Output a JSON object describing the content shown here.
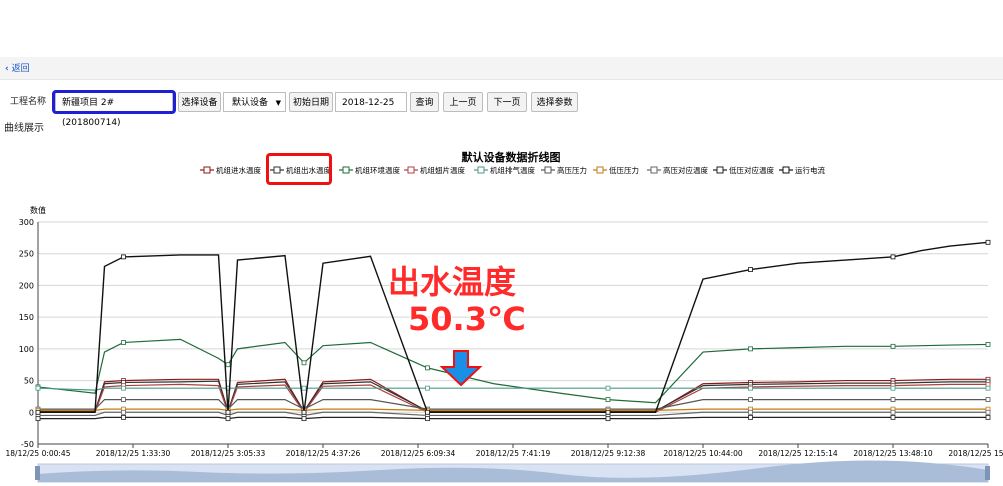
{
  "nav": {
    "back_label": "返回"
  },
  "toolbar": {
    "project_label": "工程名称",
    "project_value": "新疆项目 2#(201800714)",
    "device_label": "选择设备",
    "device_value": "默认设备",
    "date_label": "初始日期",
    "date_value": "2018-12-25",
    "query_label": "查询",
    "prev_label": "上一页",
    "next_label": "下一页",
    "params_label": "选择参数"
  },
  "section": {
    "title": "曲线展示"
  },
  "annotation": {
    "line1": "出水温度",
    "line2": "50.3℃"
  },
  "colors": {
    "highlight_blue": "#1f1fd6",
    "highlight_red": "#e11111",
    "annotation_red": "#ff2a2a",
    "arrow_blue": "#1a8fe6"
  },
  "chart_data": {
    "type": "line",
    "title": "默认设备数据折线图",
    "ylabel": "数值",
    "ylim": [
      -50,
      300
    ],
    "yticks": [
      -50,
      0,
      50,
      100,
      150,
      200,
      250,
      300
    ],
    "xticks": [
      "18/12/25 0:00:45",
      "2018/12/25 1:33:30",
      "2018/12/25 3:05:33",
      "2018/12/25 4:37:26",
      "2018/12/25 6:09:34",
      "2018/12/25 7:41:19",
      "2018/12/25 9:12:38",
      "2018/12/25 10:44:00",
      "2018/12/25 12:15:14",
      "2018/12/25 13:48:10",
      "2018/12/25 15:19:02"
    ],
    "x": [
      0,
      0.6,
      0.7,
      0.9,
      1.5,
      1.9,
      2.0,
      2.1,
      2.6,
      2.8,
      3.0,
      3.5,
      4.1,
      4.8,
      5.5,
      6.0,
      6.5,
      7.0,
      7.5,
      8.0,
      8.5,
      9.0,
      9.3,
      9.6,
      10.0
    ],
    "series": [
      {
        "name": "机组进水温度",
        "color": "#8b1a1a",
        "values": [
          1,
          1,
          48,
          50,
          52,
          52,
          1,
          47,
          52,
          1,
          48,
          52,
          1,
          1,
          1,
          1,
          1,
          45,
          47,
          48,
          50,
          50,
          51,
          52,
          52
        ]
      },
      {
        "name": "机组出水温度",
        "color": "#333333",
        "values": [
          2,
          2,
          45,
          47,
          48,
          49,
          2,
          44,
          48,
          2,
          45,
          48,
          2,
          2,
          2,
          2,
          2,
          42,
          44,
          45,
          46,
          46,
          47,
          48,
          48
        ]
      },
      {
        "name": "机组环境温度",
        "color": "#1f6b3a",
        "values": [
          40,
          30,
          95,
          110,
          115,
          85,
          75,
          100,
          110,
          78,
          105,
          110,
          70,
          45,
          30,
          20,
          15,
          95,
          100,
          102,
          104,
          104,
          105,
          106,
          107
        ]
      },
      {
        "name": "机组翅片温度",
        "color": "#b04040",
        "values": [
          0,
          0,
          40,
          42,
          44,
          42,
          0,
          40,
          43,
          0,
          41,
          43,
          0,
          0,
          0,
          0,
          0,
          38,
          40,
          41,
          42,
          42,
          43,
          44,
          44
        ]
      },
      {
        "name": "机组排气温度",
        "color": "#4a9a8a",
        "values": [
          38,
          35,
          38,
          38,
          38,
          38,
          38,
          38,
          38,
          38,
          38,
          38,
          38,
          38,
          38,
          38,
          38,
          38,
          38,
          38,
          38,
          38,
          38,
          38,
          38
        ]
      },
      {
        "name": "高压压力",
        "color": "#555555",
        "values": [
          5,
          5,
          20,
          20,
          20,
          20,
          5,
          20,
          20,
          5,
          20,
          20,
          5,
          5,
          5,
          5,
          5,
          20,
          20,
          20,
          20,
          20,
          20,
          20,
          20
        ]
      },
      {
        "name": "低压压力",
        "color": "#c07a10",
        "values": [
          3,
          3,
          5,
          5,
          5,
          5,
          3,
          5,
          5,
          3,
          5,
          5,
          3,
          3,
          3,
          3,
          3,
          5,
          5,
          5,
          5,
          5,
          5,
          5,
          5
        ]
      },
      {
        "name": "高压对应温度",
        "color": "#666666",
        "values": [
          -5,
          -5,
          0,
          0,
          0,
          0,
          -5,
          0,
          0,
          -5,
          0,
          0,
          -5,
          -5,
          -5,
          -5,
          -5,
          0,
          0,
          0,
          0,
          0,
          0,
          0,
          0
        ]
      },
      {
        "name": "低压对应温度",
        "color": "#222222",
        "values": [
          -10,
          -10,
          -8,
          -8,
          -8,
          -8,
          -10,
          -8,
          -8,
          -10,
          -8,
          -8,
          -10,
          -10,
          -10,
          -10,
          -10,
          -8,
          -8,
          -8,
          -8,
          -8,
          -8,
          -8,
          -8
        ]
      },
      {
        "name": "运行电流",
        "color": "#111111",
        "values": [
          0,
          0,
          230,
          245,
          248,
          248,
          0,
          240,
          247,
          0,
          235,
          246,
          0,
          0,
          0,
          0,
          0,
          210,
          225,
          235,
          240,
          245,
          255,
          262,
          268
        ]
      }
    ],
    "grid": true,
    "legend_position": "top"
  }
}
